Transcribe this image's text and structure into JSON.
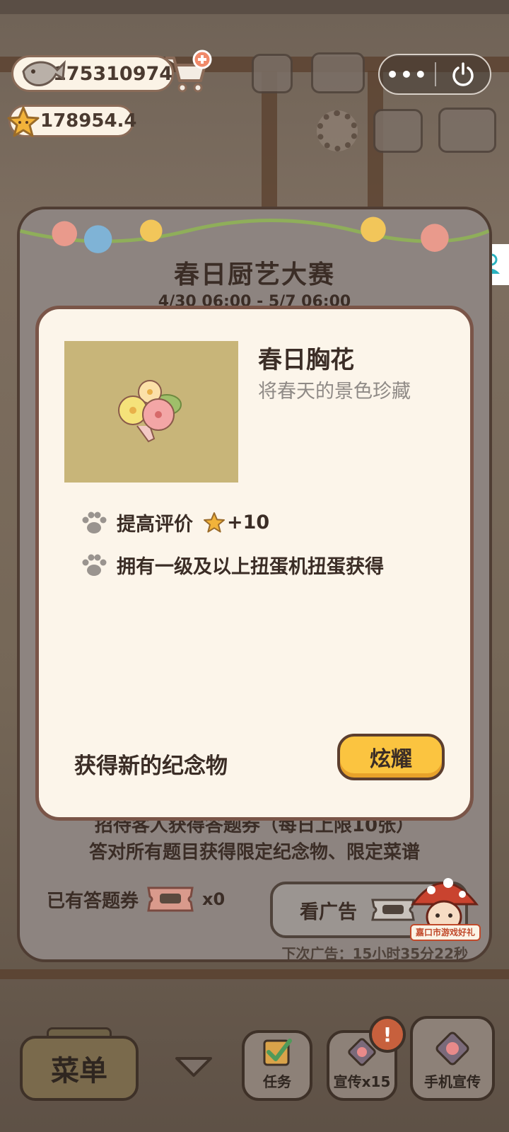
{
  "hud": {
    "fish_count": "175310974",
    "star_count": "178954.4"
  },
  "system": {
    "more_label": "•••"
  },
  "event": {
    "title": "春日厨艺大赛",
    "dates": "4/30 06:00 - 5/7 06:00",
    "desc_line1": "招待客人获得答题券（每日上限10张）",
    "desc_line2": "答对所有题目获得限定纪念物、限定菜谱",
    "ticket_label": "已有答题券",
    "ticket_count": "x0",
    "ad_button": "看广告",
    "next_ad": "下次广告：15小时35分22秒"
  },
  "souvenir": {
    "name": "春日胸花",
    "tagline": "将春天的景色珍藏",
    "effects": [
      {
        "text": "提高评价",
        "bonus": "+10"
      },
      {
        "text": "拥有一级及以上扭蛋机扭蛋获得"
      }
    ],
    "footer_text": "获得新的纪念物",
    "show_off_button": "炫耀"
  },
  "watermark": "嘉口市游戏好礼",
  "bottom_bar": {
    "menu": "菜单",
    "task": "任务",
    "promo": "宣传x15",
    "phone_promo": "手机宣传",
    "alert": "!"
  },
  "colors": {
    "accent_yellow": "#fbc440",
    "card_bg": "#fcf5ea",
    "frame_brown": "#7a5548"
  }
}
